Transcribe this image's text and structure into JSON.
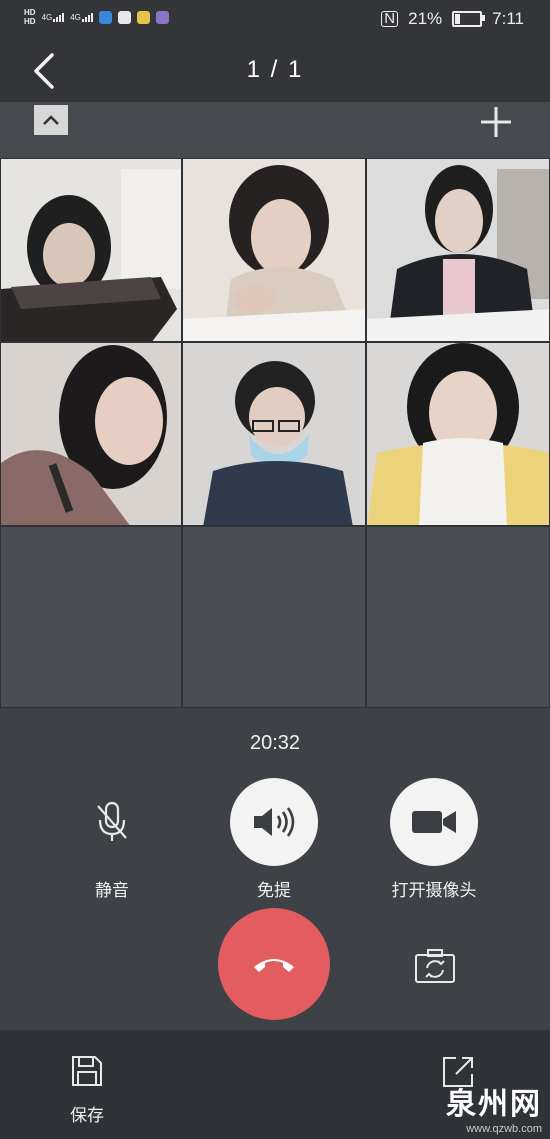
{
  "status_bar": {
    "left_badges": [
      "HD",
      "HD"
    ],
    "network": [
      "4G",
      "4G"
    ],
    "battery_percent": "21%",
    "battery_level": 0.21,
    "time": "7:11"
  },
  "header": {
    "title": "1 / 1"
  },
  "call": {
    "participants": [
      {
        "tile": "participant-1"
      },
      {
        "tile": "participant-2"
      },
      {
        "tile": "participant-3"
      },
      {
        "tile": "participant-4"
      },
      {
        "tile": "participant-5"
      },
      {
        "tile": "participant-6"
      }
    ],
    "empty_slots": 3,
    "duration": "20:32"
  },
  "controls": {
    "mute_label": "静音",
    "speaker_label": "免提",
    "camera_label": "打开摄像头"
  },
  "bottom": {
    "save_label": "保存",
    "watermark_name": "泉州网",
    "watermark_url": "www.qzwb.com"
  },
  "icons": {
    "back": "chevron-left-icon",
    "collapse": "chevron-up-icon",
    "add": "plus-icon",
    "mute": "mic-off-icon",
    "speaker": "speaker-icon",
    "camera": "video-camera-icon",
    "hangup": "phone-hangup-icon",
    "flip": "camera-switch-icon",
    "save": "floppy-icon",
    "share": "share-external-icon"
  },
  "colors": {
    "hangup": "#e35c5f",
    "background": "#3c3f44"
  }
}
